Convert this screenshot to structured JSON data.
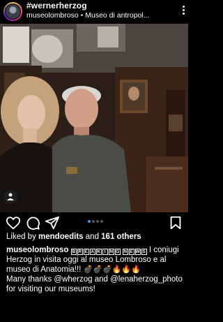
{
  "header": {
    "hashtag": "#wernerherzog",
    "username": "museolombroso",
    "separator": "•",
    "location": "Museo di antropol..."
  },
  "post": {
    "carousel": {
      "count": 4,
      "active": 1
    },
    "likes_prefix": "Liked by ",
    "likes_user": "mendoedits",
    "likes_middle": " and ",
    "likes_others": "161 others",
    "caption_user": "museolombroso",
    "breaking": [
      "B",
      "R",
      "E",
      "A",
      "K",
      "I",
      "N",
      "G"
    ],
    "news": [
      "N",
      "E",
      "W",
      "S"
    ],
    "caption_text_1": " I coniugi Herzog in visita oggi al museo Lombroso e al museo di Anatomia!!! ",
    "caption_emojis_1": "💣💣💣🔥🔥🔥",
    "caption_text_2": "Many thanks @wherzog and @lenaherzog_photo for visiting our museums!"
  },
  "icons": [
    "heart-icon",
    "comment-icon",
    "share-icon",
    "bookmark-icon",
    "user-tag-icon",
    "more-options-icon"
  ],
  "colors": {
    "background": "#000000",
    "text": "#ffffff",
    "active_dot": "#3897f0",
    "inactive_dot": "#555555"
  }
}
